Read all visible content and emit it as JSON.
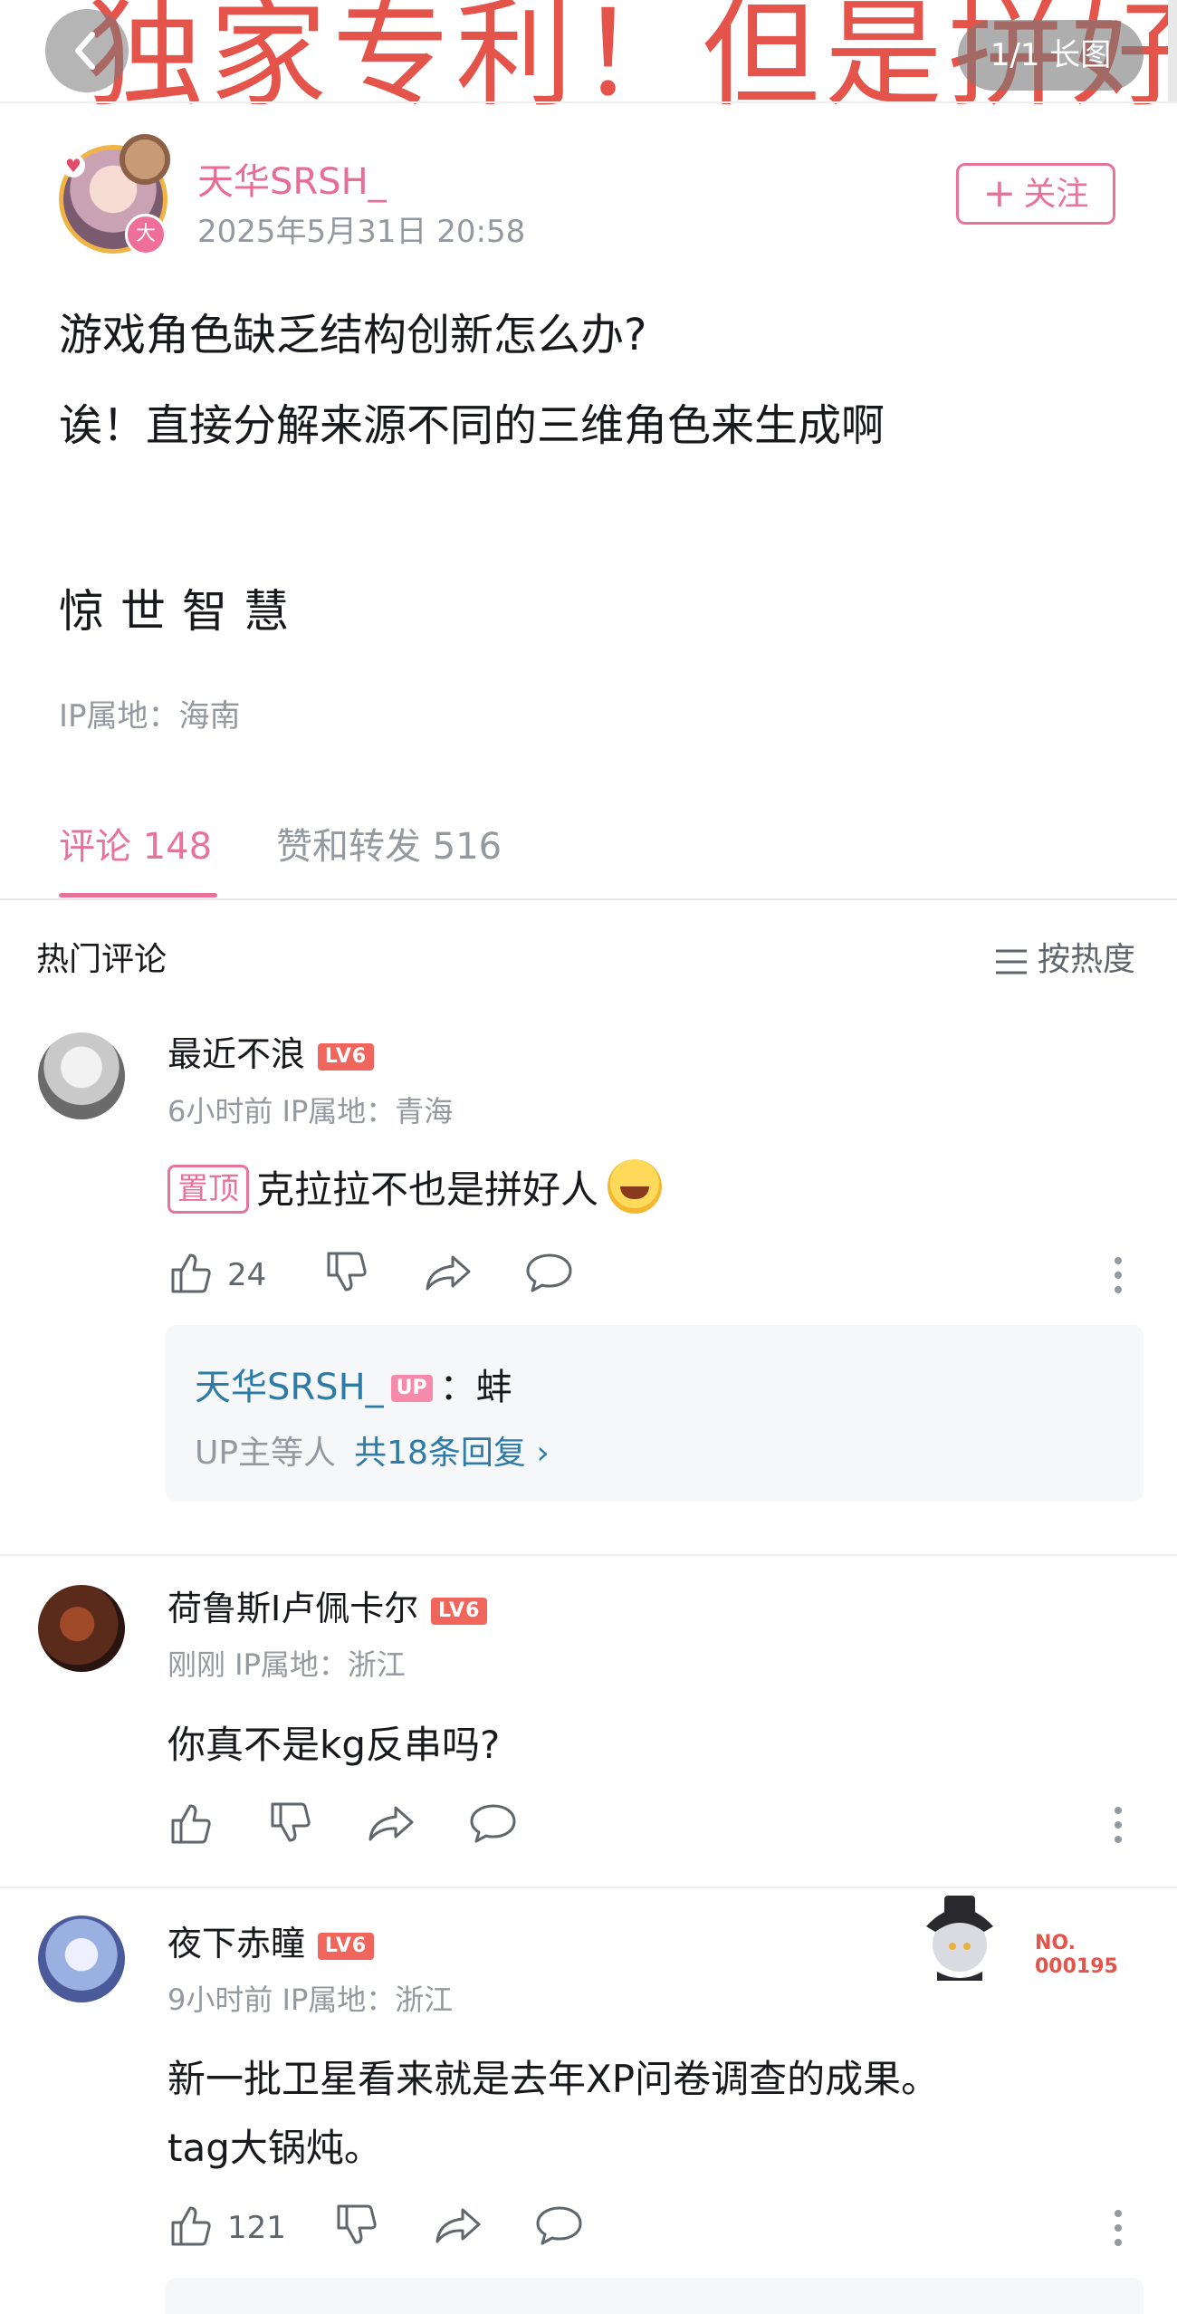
{
  "overlay": {
    "title_text": "独家专利！但是拼好",
    "page_indicator": "1/1",
    "long_image_label": "长图"
  },
  "post": {
    "author": "天华SRSH_",
    "avatar_badge": "大",
    "datetime": "2025年5月31日 20:58",
    "follow_label": "关注",
    "lines": [
      "游戏角色缺乏结构创新怎么办?",
      "诶！直接分解来源不同的三维角色来生成啊"
    ],
    "wisdom": "惊世智慧",
    "ip": "IP属地：海南"
  },
  "tabs": {
    "comments": "评论 148",
    "likes_shares": "赞和转发 516"
  },
  "comments_section": {
    "title": "热门评论",
    "sort_label": "按热度"
  },
  "comments": [
    {
      "name": "最近不浪",
      "level": "LV6",
      "meta": "6小时前 IP属地：青海",
      "pin_label": "置顶",
      "text": "克拉拉不也是拼好人",
      "likes": "24",
      "reply": {
        "author": "天华SRSH_",
        "up_badge": "UP",
        "text": "：蚌",
        "summary": "UP主等人",
        "more": "共18条回复"
      }
    },
    {
      "name": "荷鲁斯I卢佩卡尔",
      "level": "LV6",
      "meta": "刚刚 IP属地：浙江",
      "text": "你真不是kg反串吗?"
    },
    {
      "name": "夜下赤瞳",
      "level": "LV6",
      "meta": "9小时前 IP属地：浙江",
      "text_lines": [
        "新一批卫星看来就是去年XP问卷调查的成果。",
        "tag大锅炖。"
      ],
      "likes": "121",
      "medal_no_1": "NO.",
      "medal_no_2": "000195"
    }
  ],
  "colors": {
    "accent_pink": "#e7739b",
    "overlay_red": "#e4544a",
    "link_blue": "#2d7ba6",
    "level_red": "#f0665c",
    "meta_gray": "#9499a0"
  }
}
